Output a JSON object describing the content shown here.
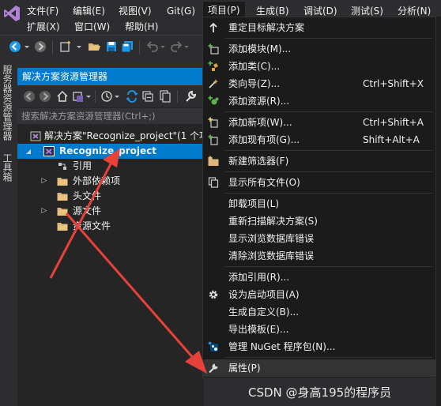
{
  "menubar": {
    "row1": [
      {
        "label": "文件(F)"
      },
      {
        "label": "编辑(E)"
      },
      {
        "label": "视图(V)"
      },
      {
        "label": "Git(G)"
      },
      {
        "label": "项目(P)"
      },
      {
        "label": "生成(B)"
      },
      {
        "label": "调试(D)"
      },
      {
        "label": "测试(S)"
      },
      {
        "label": "分析(N)"
      }
    ],
    "row2": [
      {
        "label": "扩展(X)"
      },
      {
        "label": "窗口(W)"
      },
      {
        "label": "帮助(H)"
      }
    ]
  },
  "leftstrip": {
    "tab1": "服务器资源管理器",
    "tab2": "工具箱"
  },
  "explorer": {
    "title": "解决方案资源管理器",
    "search_placeholder": "搜索解决方案资源管理器(Ctrl+;)",
    "tree": [
      {
        "label": "解决方案\"Recognize_project\"(1 个项",
        "icon": "solution-icon"
      },
      {
        "label": "Recognize_project",
        "icon": "cpp-project-icon"
      },
      {
        "label": "引用",
        "icon": "references-icon"
      },
      {
        "label": "外部依赖项",
        "icon": "folder-icon"
      },
      {
        "label": "头文件",
        "icon": "folder-icon"
      },
      {
        "label": "源文件",
        "icon": "folder-icon"
      },
      {
        "label": "资源文件",
        "icon": "folder-icon"
      }
    ]
  },
  "dropdown": {
    "items": [
      {
        "label": "重定目标解决方案",
        "shortcut": "",
        "icon": "arrow-up-icon"
      },
      {
        "label": "添加模块(M)...",
        "shortcut": "",
        "icon": "add-module-icon"
      },
      {
        "label": "添加类(C)...",
        "shortcut": "",
        "icon": "add-class-icon"
      },
      {
        "label": "类向导(Z)...",
        "shortcut": "Ctrl+Shift+X",
        "icon": "class-wizard-icon"
      },
      {
        "label": "添加资源(R)...",
        "shortcut": "",
        "icon": "add-resource-icon"
      },
      {
        "label": "添加新项(W)...",
        "shortcut": "Ctrl+Shift+A",
        "icon": "add-new-item-icon"
      },
      {
        "label": "添加现有项(G)...",
        "shortcut": "Shift+Alt+A",
        "icon": "add-existing-item-icon"
      },
      {
        "label": "新建筛选器(F)",
        "shortcut": "",
        "icon": "new-filter-icon"
      },
      {
        "label": "显示所有文件(O)",
        "shortcut": "",
        "icon": "show-all-files-icon"
      },
      {
        "label": "卸载项目(L)",
        "shortcut": "",
        "icon": ""
      },
      {
        "label": "重新扫描解决方案(S)",
        "shortcut": "",
        "icon": ""
      },
      {
        "label": "显示浏览数据库错误",
        "shortcut": "",
        "icon": ""
      },
      {
        "label": "清除浏览数据库错误",
        "shortcut": "",
        "icon": ""
      },
      {
        "label": "添加引用(R)...",
        "shortcut": "",
        "icon": ""
      },
      {
        "label": "设为启动项目(A)",
        "shortcut": "",
        "icon": "gear-icon"
      },
      {
        "label": "生成自定义(B)...",
        "shortcut": "",
        "icon": ""
      },
      {
        "label": "导出模板(E)...",
        "shortcut": "",
        "icon": ""
      },
      {
        "label": "管理 NuGet 程序包(N)...",
        "shortcut": "",
        "icon": "nuget-icon"
      },
      {
        "label": "属性(P)",
        "shortcut": "",
        "icon": "wrench-icon"
      }
    ]
  },
  "watermark": "CSDN @身高195的程序员",
  "colors": {
    "accent": "#007acc",
    "arrow": "#e8413a",
    "menu_bg": "#1b1b1c",
    "chrome_bg": "#2d2d30"
  }
}
